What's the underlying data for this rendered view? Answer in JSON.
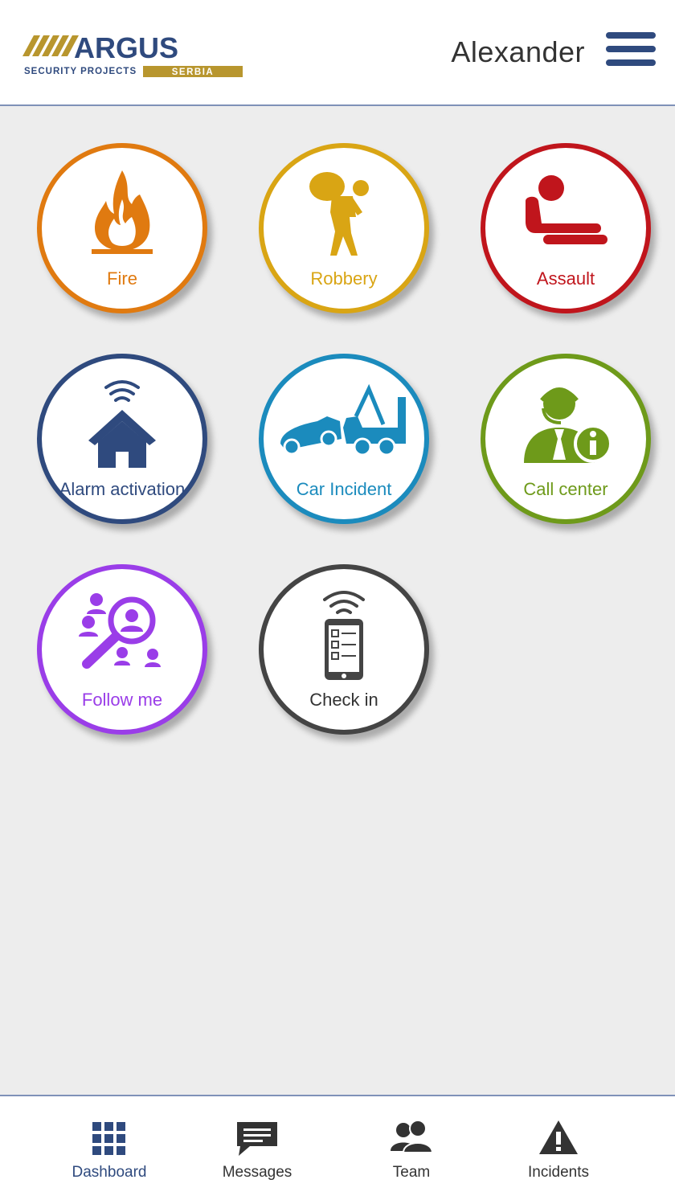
{
  "header": {
    "logo_text": "ARGUS",
    "logo_sub_left": "SECURITY PROJECTS",
    "logo_sub_right": "SERBIA",
    "username": "Alexander",
    "menu_icon": "hamburger-menu-icon"
  },
  "tiles": [
    {
      "label": "Fire",
      "icon": "fire-icon",
      "color": "#e07a10"
    },
    {
      "label": "Robbery",
      "icon": "robber-icon",
      "color": "#d9a514"
    },
    {
      "label": "Assault",
      "icon": "assault-icon",
      "color": "#c0151c"
    },
    {
      "label": "Alarm activation",
      "icon": "alarm-house-icon",
      "color": "#2f4a7e"
    },
    {
      "label": "Car Incident",
      "icon": "tow-truck-icon",
      "color": "#1b8bbd"
    },
    {
      "label": "Call center",
      "icon": "call-center-agent-icon",
      "color": "#6e9a1a"
    },
    {
      "label": "Follow me",
      "icon": "follow-me-search-icon",
      "color": "#9a3de8"
    },
    {
      "label": "Check in",
      "icon": "phone-checklist-icon",
      "color": "#444444"
    }
  ],
  "bottom_nav": [
    {
      "label": "Dashboard",
      "icon": "dashboard-grid-icon",
      "active": true
    },
    {
      "label": "Messages",
      "icon": "message-bubble-icon",
      "active": false
    },
    {
      "label": "Team",
      "icon": "team-icon",
      "active": false
    },
    {
      "label": "Incidents",
      "icon": "warning-triangle-icon",
      "active": false
    }
  ],
  "colors": {
    "brand_navy": "#2f4a7e",
    "brand_gold": "#b8962e",
    "background": "#ededed"
  }
}
